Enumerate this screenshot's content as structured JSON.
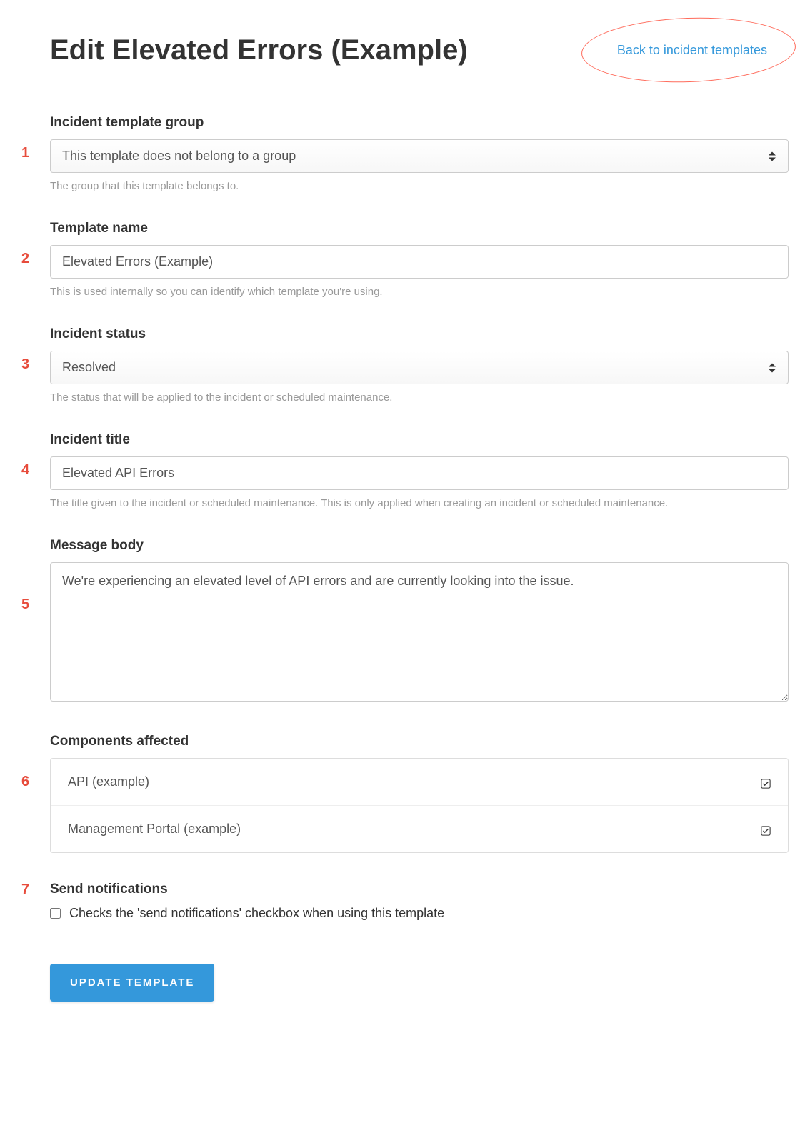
{
  "header": {
    "title": "Edit Elevated Errors (Example)",
    "back_link": "Back to incident templates"
  },
  "annotations": {
    "n1": "1",
    "n2": "2",
    "n3": "3",
    "n4": "4",
    "n5": "5",
    "n6": "6",
    "n7": "7"
  },
  "fields": {
    "group": {
      "label": "Incident template group",
      "value": "This template does not belong to a group",
      "help": "The group that this template belongs to."
    },
    "template_name": {
      "label": "Template name",
      "value": "Elevated Errors (Example)",
      "help": "This is used internally so you can identify which template you're using."
    },
    "incident_status": {
      "label": "Incident status",
      "value": "Resolved",
      "help": "The status that will be applied to the incident or scheduled maintenance."
    },
    "incident_title": {
      "label": "Incident title",
      "value": "Elevated API Errors",
      "help": "The title given to the incident or scheduled maintenance. This is only applied when creating an incident or scheduled maintenance."
    },
    "message_body": {
      "label": "Message body",
      "value": "We're experiencing an elevated level of API errors and are currently looking into the issue."
    },
    "components": {
      "label": "Components affected",
      "items": [
        {
          "name": "API (example)",
          "checked": true
        },
        {
          "name": "Management Portal (example)",
          "checked": true
        }
      ]
    },
    "send_notifications": {
      "label": "Send notifications",
      "desc": "Checks the 'send notifications' checkbox when using this template",
      "checked": false
    }
  },
  "actions": {
    "update": "UPDATE TEMPLATE"
  }
}
